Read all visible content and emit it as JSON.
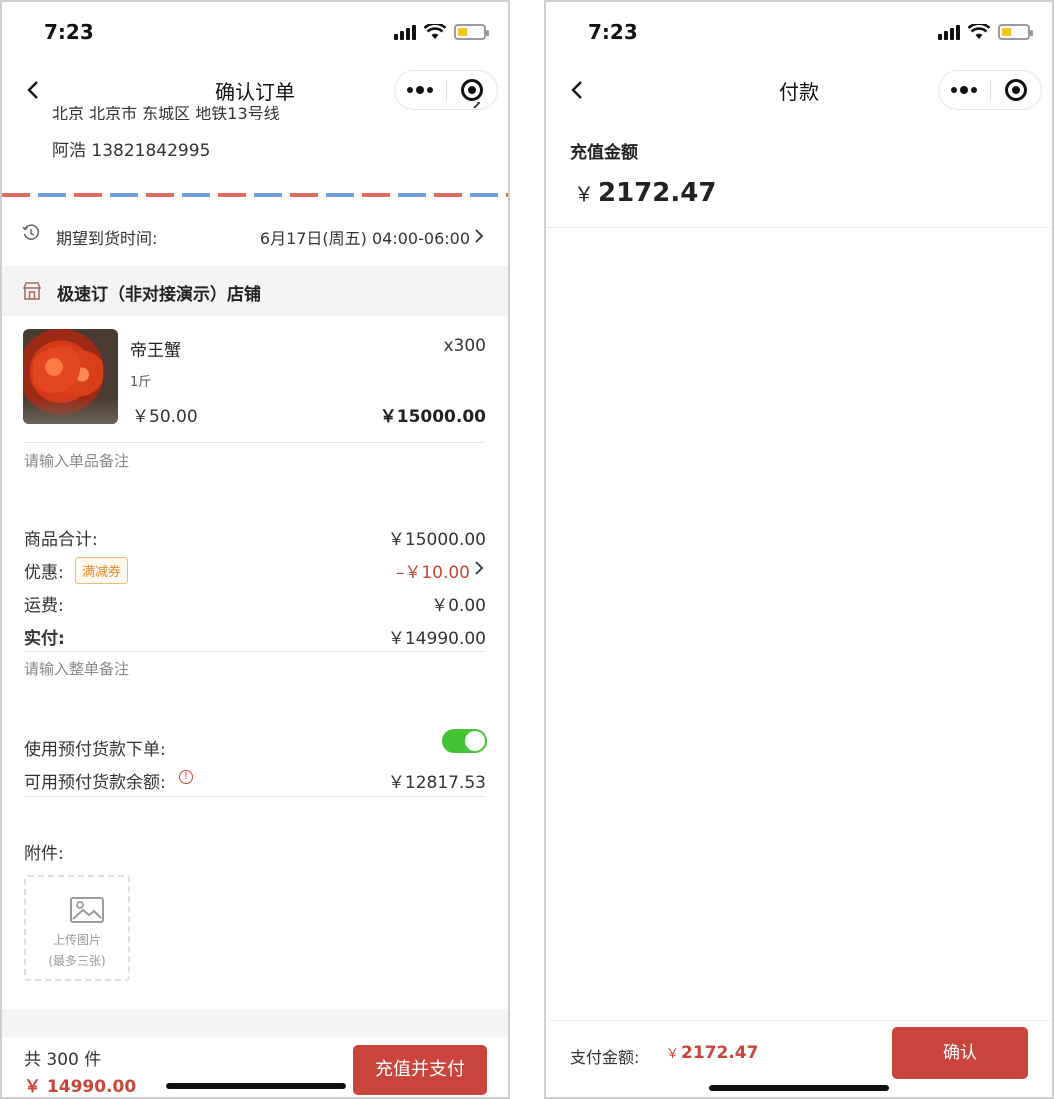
{
  "left": {
    "status": {
      "time": "7:23"
    },
    "nav": {
      "title": "确认订单"
    },
    "address": {
      "line": "北京 北京市 东城区 地铁13号线",
      "contact": "阿浩 13821842995"
    },
    "delivery": {
      "label": "期望到货时间:",
      "value": "6月17日(周五) 04:00-06:00"
    },
    "store": {
      "name": "极速订（非对接演示）店铺"
    },
    "product": {
      "name": "帝王蟹",
      "qty": "x300",
      "spec": "1斤",
      "price": "￥50.00",
      "subtotal": "￥15000.00",
      "note_placeholder": "请输入单品备注"
    },
    "summary": {
      "goods_label": "商品合计:",
      "goods_value": "￥15000.00",
      "discount_label": "优惠:",
      "coupon_tag": "满减券",
      "discount_value": "–￥10.00",
      "shipping_label": "运费:",
      "shipping_value": "￥0.00",
      "paid_label": "实付:",
      "paid_value": "￥14990.00",
      "order_note_placeholder": "请输入整单备注"
    },
    "prepay": {
      "use_label": "使用预付货款下单:",
      "use_enabled": true,
      "balance_label": "可用预付货款余额:",
      "balance_value": "￥12817.53",
      "info_glyph": "!"
    },
    "attachment": {
      "label": "附件:",
      "upload_text": "上传图片",
      "upload_hint": "(最多三张)"
    },
    "bottom": {
      "count": "共 300 件",
      "total": "￥ 14990.00",
      "pay_button": "充值并支付"
    }
  },
  "right": {
    "status": {
      "time": "7:23"
    },
    "nav": {
      "title": "付款"
    },
    "recharge": {
      "label": "充值金额",
      "currency": "￥",
      "amount": "2172.47"
    },
    "bottom": {
      "pay_label": "支付金额:",
      "currency": "￥",
      "pay_amount": "2172.47",
      "confirm_button": "确认"
    }
  },
  "colors": {
    "accent": "#c9453b",
    "toggle_on": "#44c435",
    "coupon": "#e38a2b"
  },
  "icons": [
    "back-chevron-icon",
    "more-dots-icon",
    "close-target-icon",
    "clock-icon",
    "store-icon",
    "chevron-right-icon",
    "info-icon",
    "image-icon",
    "signal-icon",
    "wifi-icon",
    "battery-icon"
  ]
}
